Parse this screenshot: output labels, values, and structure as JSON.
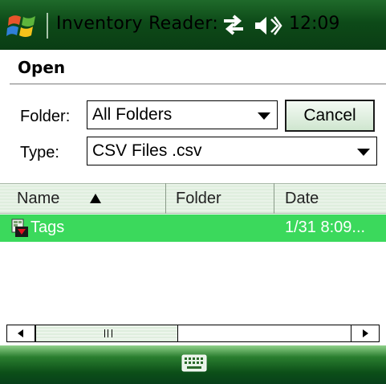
{
  "titlebar": {
    "app_title": "Inventory Reader:",
    "time": "12:09"
  },
  "dialog": {
    "title": "Open",
    "folder_label": "Folder:",
    "folder_value": "All Folders",
    "type_label": "Type:",
    "type_value": "CSV Files .csv",
    "cancel_label": "Cancel"
  },
  "list": {
    "columns": [
      "Name",
      "Folder",
      "Date"
    ],
    "sort_column": "Name",
    "sort_direction": "ascending",
    "rows": [
      {
        "name": "Tags",
        "folder": "",
        "date": "1/31 8:09...",
        "selected": true
      }
    ]
  },
  "icons": {
    "start": "windows-logo-icon",
    "connectivity": "connectivity-arrows-icon",
    "volume": "speaker-icon",
    "sort": "sort-ascending-icon",
    "file": "csv-file-icon",
    "keyboard": "keyboard-icon"
  },
  "colors": {
    "titlebar": "#0d4a18",
    "selection": "#3bd95c",
    "accent_light": "#dfeede"
  }
}
